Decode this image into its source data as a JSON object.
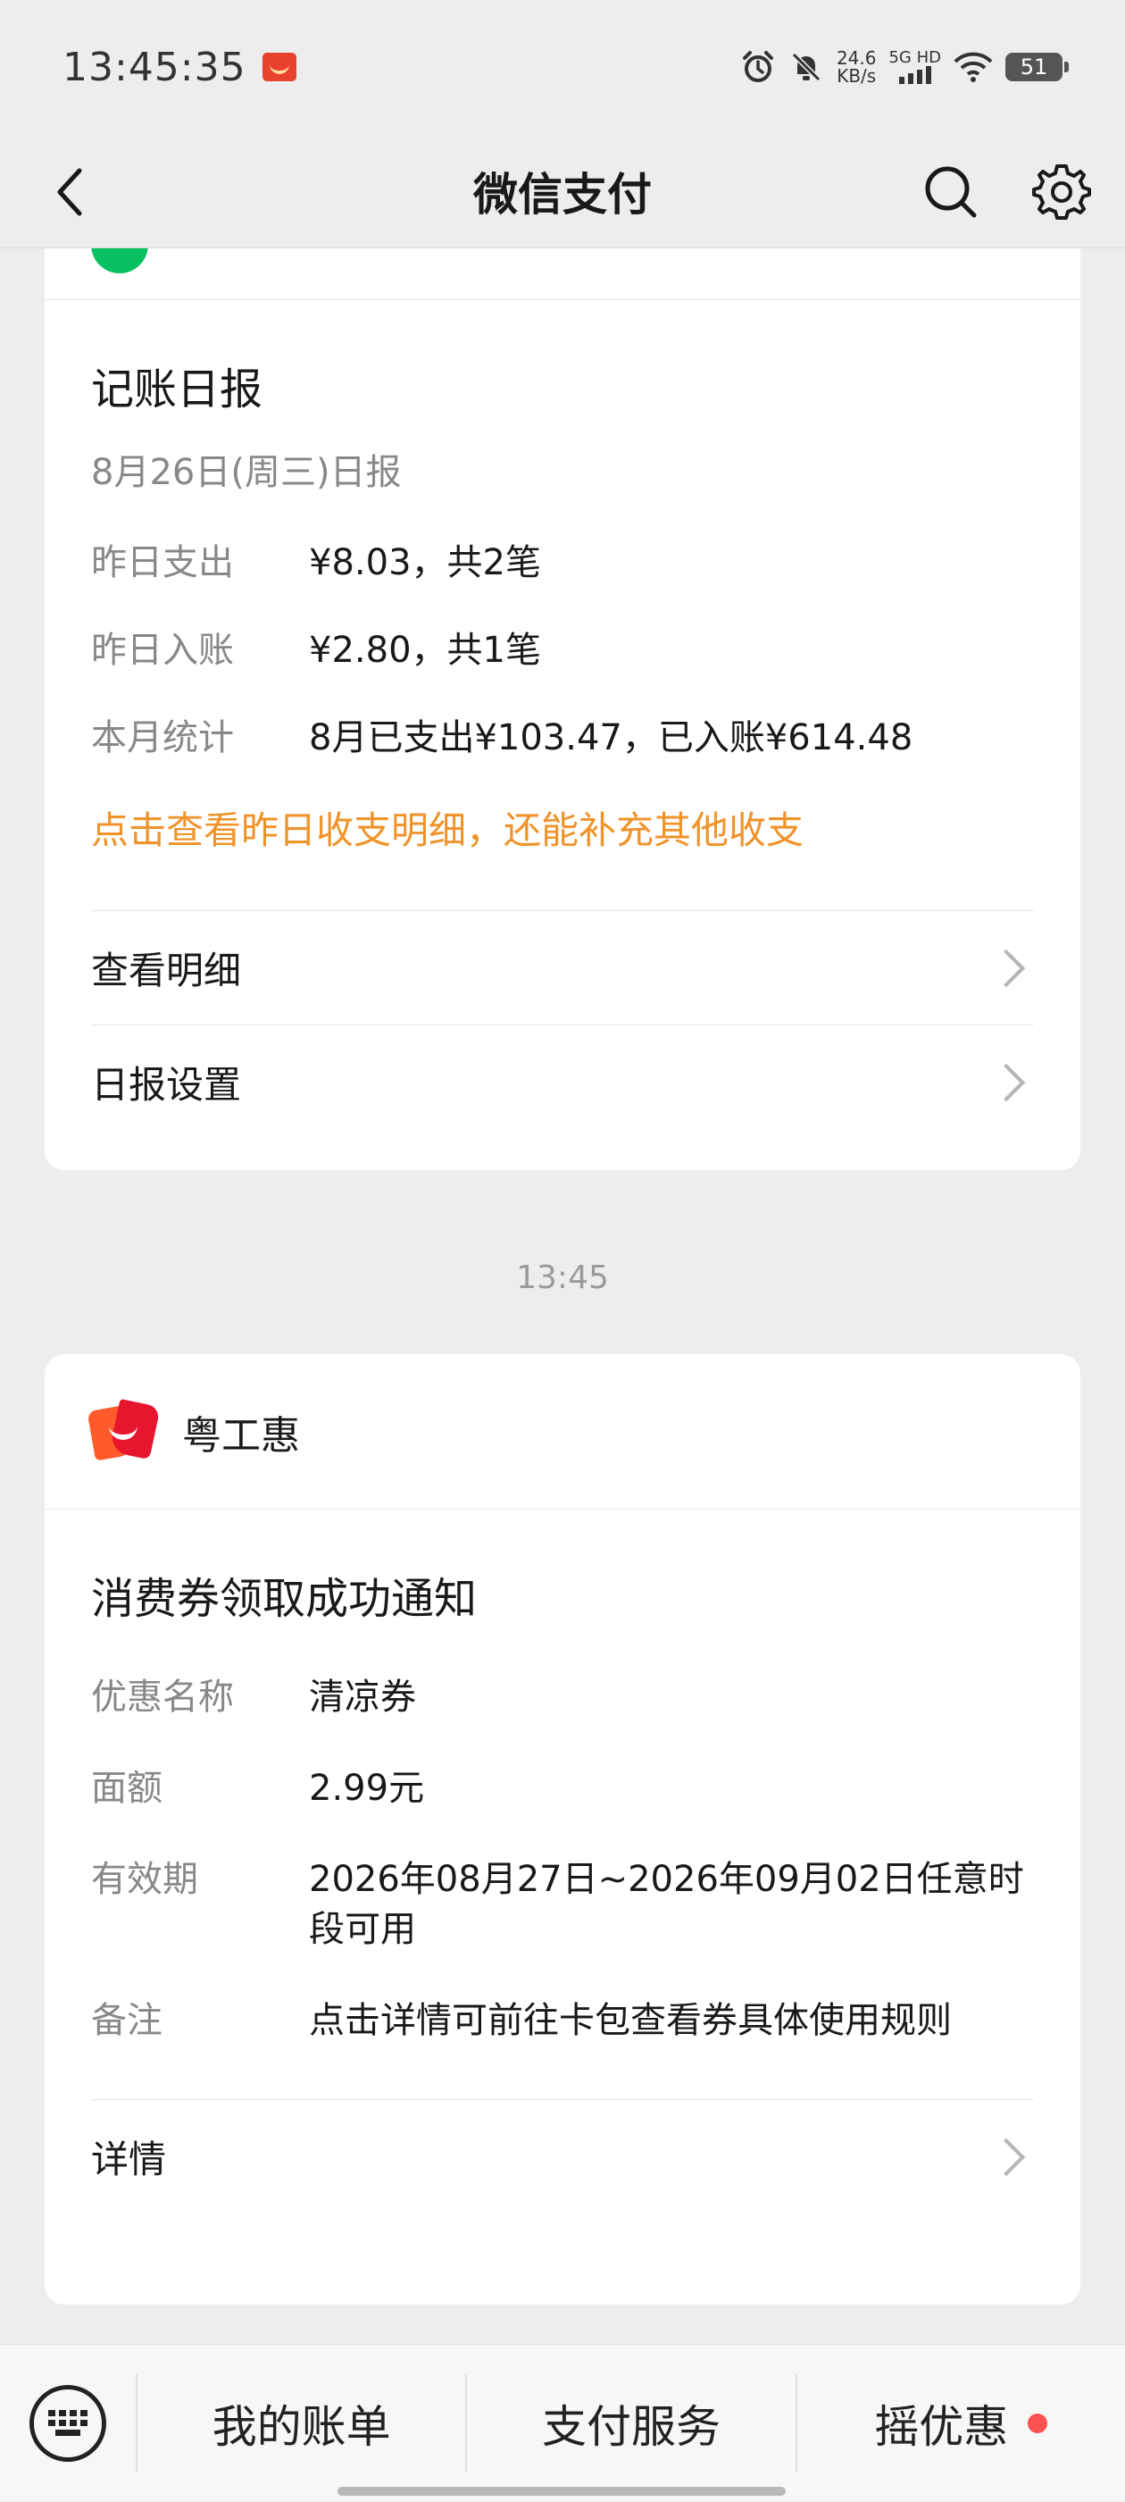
{
  "status_bar": {
    "time": "13:45:35",
    "net_speed_value": "24.6",
    "net_speed_unit": "KB/s",
    "network_type": "5G HD",
    "battery": "51"
  },
  "nav": {
    "title": "微信支付"
  },
  "daily_report": {
    "title": "记账日报",
    "subtitle": "8月26日(周三)日报",
    "rows": [
      {
        "label": "昨日支出",
        "value": "¥8.03，共2笔"
      },
      {
        "label": "昨日入账",
        "value": "¥2.80，共1笔"
      },
      {
        "label": "本月统计",
        "value": "8月已支出¥103.47，已入账¥614.48"
      }
    ],
    "highlight": "点击查看昨日收支明细，还能补充其他收支",
    "menu": [
      {
        "label": "查看明细"
      },
      {
        "label": "日报设置"
      }
    ]
  },
  "timestamp": "13:45",
  "coupon_card": {
    "brand": "粤工惠",
    "title": "消费券领取成功通知",
    "rows": [
      {
        "label": "优惠名称",
        "value": "清凉券"
      },
      {
        "label": "面额",
        "value": "2.99元"
      },
      {
        "label": "有效期",
        "value": "2026年08月27日~2026年09月02日任意时段可用"
      },
      {
        "label": "备注",
        "value": "点击详情可前往卡包查看券具体使用规则"
      }
    ],
    "details_label": "详情"
  },
  "bottom_bar": {
    "tabs": [
      "我的账单",
      "支付服务",
      "摇优惠"
    ],
    "accent": "#fa5151"
  }
}
